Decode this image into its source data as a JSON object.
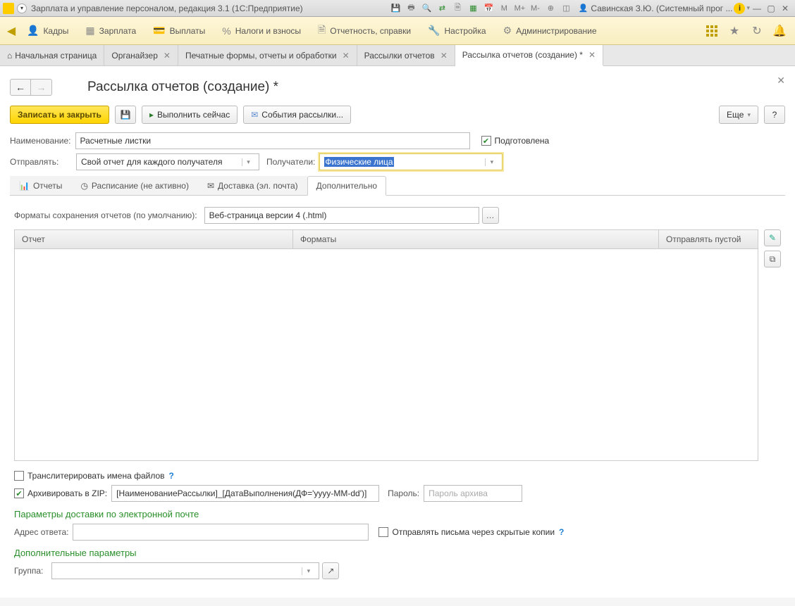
{
  "titlebar": {
    "title": "Зарплата и управление персоналом, редакция 3.1  (1С:Предприятие)",
    "user": "Савинская З.Ю. (Системный прог ...",
    "m": "M",
    "mplus": "M+",
    "mminus": "M-"
  },
  "mainmenu": {
    "items": [
      {
        "label": "Кадры",
        "icon": "👤"
      },
      {
        "label": "Зарплата",
        "icon": "▦"
      },
      {
        "label": "Выплаты",
        "icon": "💳"
      },
      {
        "label": "Налоги и взносы",
        "icon": "%"
      },
      {
        "label": "Отчетность, справки",
        "icon": "🗎"
      },
      {
        "label": "Настройка",
        "icon": "🔧"
      },
      {
        "label": "Администрирование",
        "icon": "⚙"
      }
    ]
  },
  "tabs": [
    {
      "label": "Начальная страница",
      "icon": "⌂",
      "closable": false
    },
    {
      "label": "Органайзер",
      "closable": true
    },
    {
      "label": "Печатные формы, отчеты и обработки",
      "closable": true
    },
    {
      "label": "Рассылки отчетов",
      "closable": true
    },
    {
      "label": "Рассылка отчетов (создание) *",
      "closable": true,
      "active": true
    }
  ],
  "form": {
    "title": "Рассылка отчетов (создание) *",
    "toolbar": {
      "save_close": "Записать и закрыть",
      "run_now": "Выполнить сейчас",
      "events": "События рассылки...",
      "more": "Еще"
    },
    "fields": {
      "name_label": "Наименование:",
      "name_value": "Расчетные листки",
      "prepared": "Подготовлена",
      "send_label": "Отправлять:",
      "send_value": "Свой отчет для каждого получателя",
      "recipients_label": "Получатели:",
      "recipients_value": "Физические лица"
    },
    "inner_tabs": [
      {
        "label": "Отчеты",
        "icon": "📊"
      },
      {
        "label": "Расписание (не активно)",
        "icon": "◷"
      },
      {
        "label": "Доставка (эл. почта)",
        "icon": "✉"
      },
      {
        "label": "Дополнительно",
        "active": true
      }
    ],
    "formats": {
      "label": "Форматы сохранения отчетов (по умолчанию):",
      "value": "Веб-страница версии 4 (.html)"
    },
    "grid": {
      "cols": [
        "Отчет",
        "Форматы",
        "Отправлять пустой"
      ]
    },
    "translit": "Транслитерировать имена файлов",
    "zip": {
      "label": "Архивировать в ZIP:",
      "value": "[НаименованиеРассылки]_[ДатаВыполнения(ДФ='yyyy-MM-dd')]",
      "pass_label": "Пароль:",
      "pass_placeholder": "Пароль архива"
    },
    "email_section": "Параметры доставки по электронной почте",
    "reply_label": "Адрес ответа:",
    "bcc_label": "Отправлять письма через скрытые копии",
    "extra_section": "Дополнительные параметры",
    "group_label": "Группа:"
  }
}
